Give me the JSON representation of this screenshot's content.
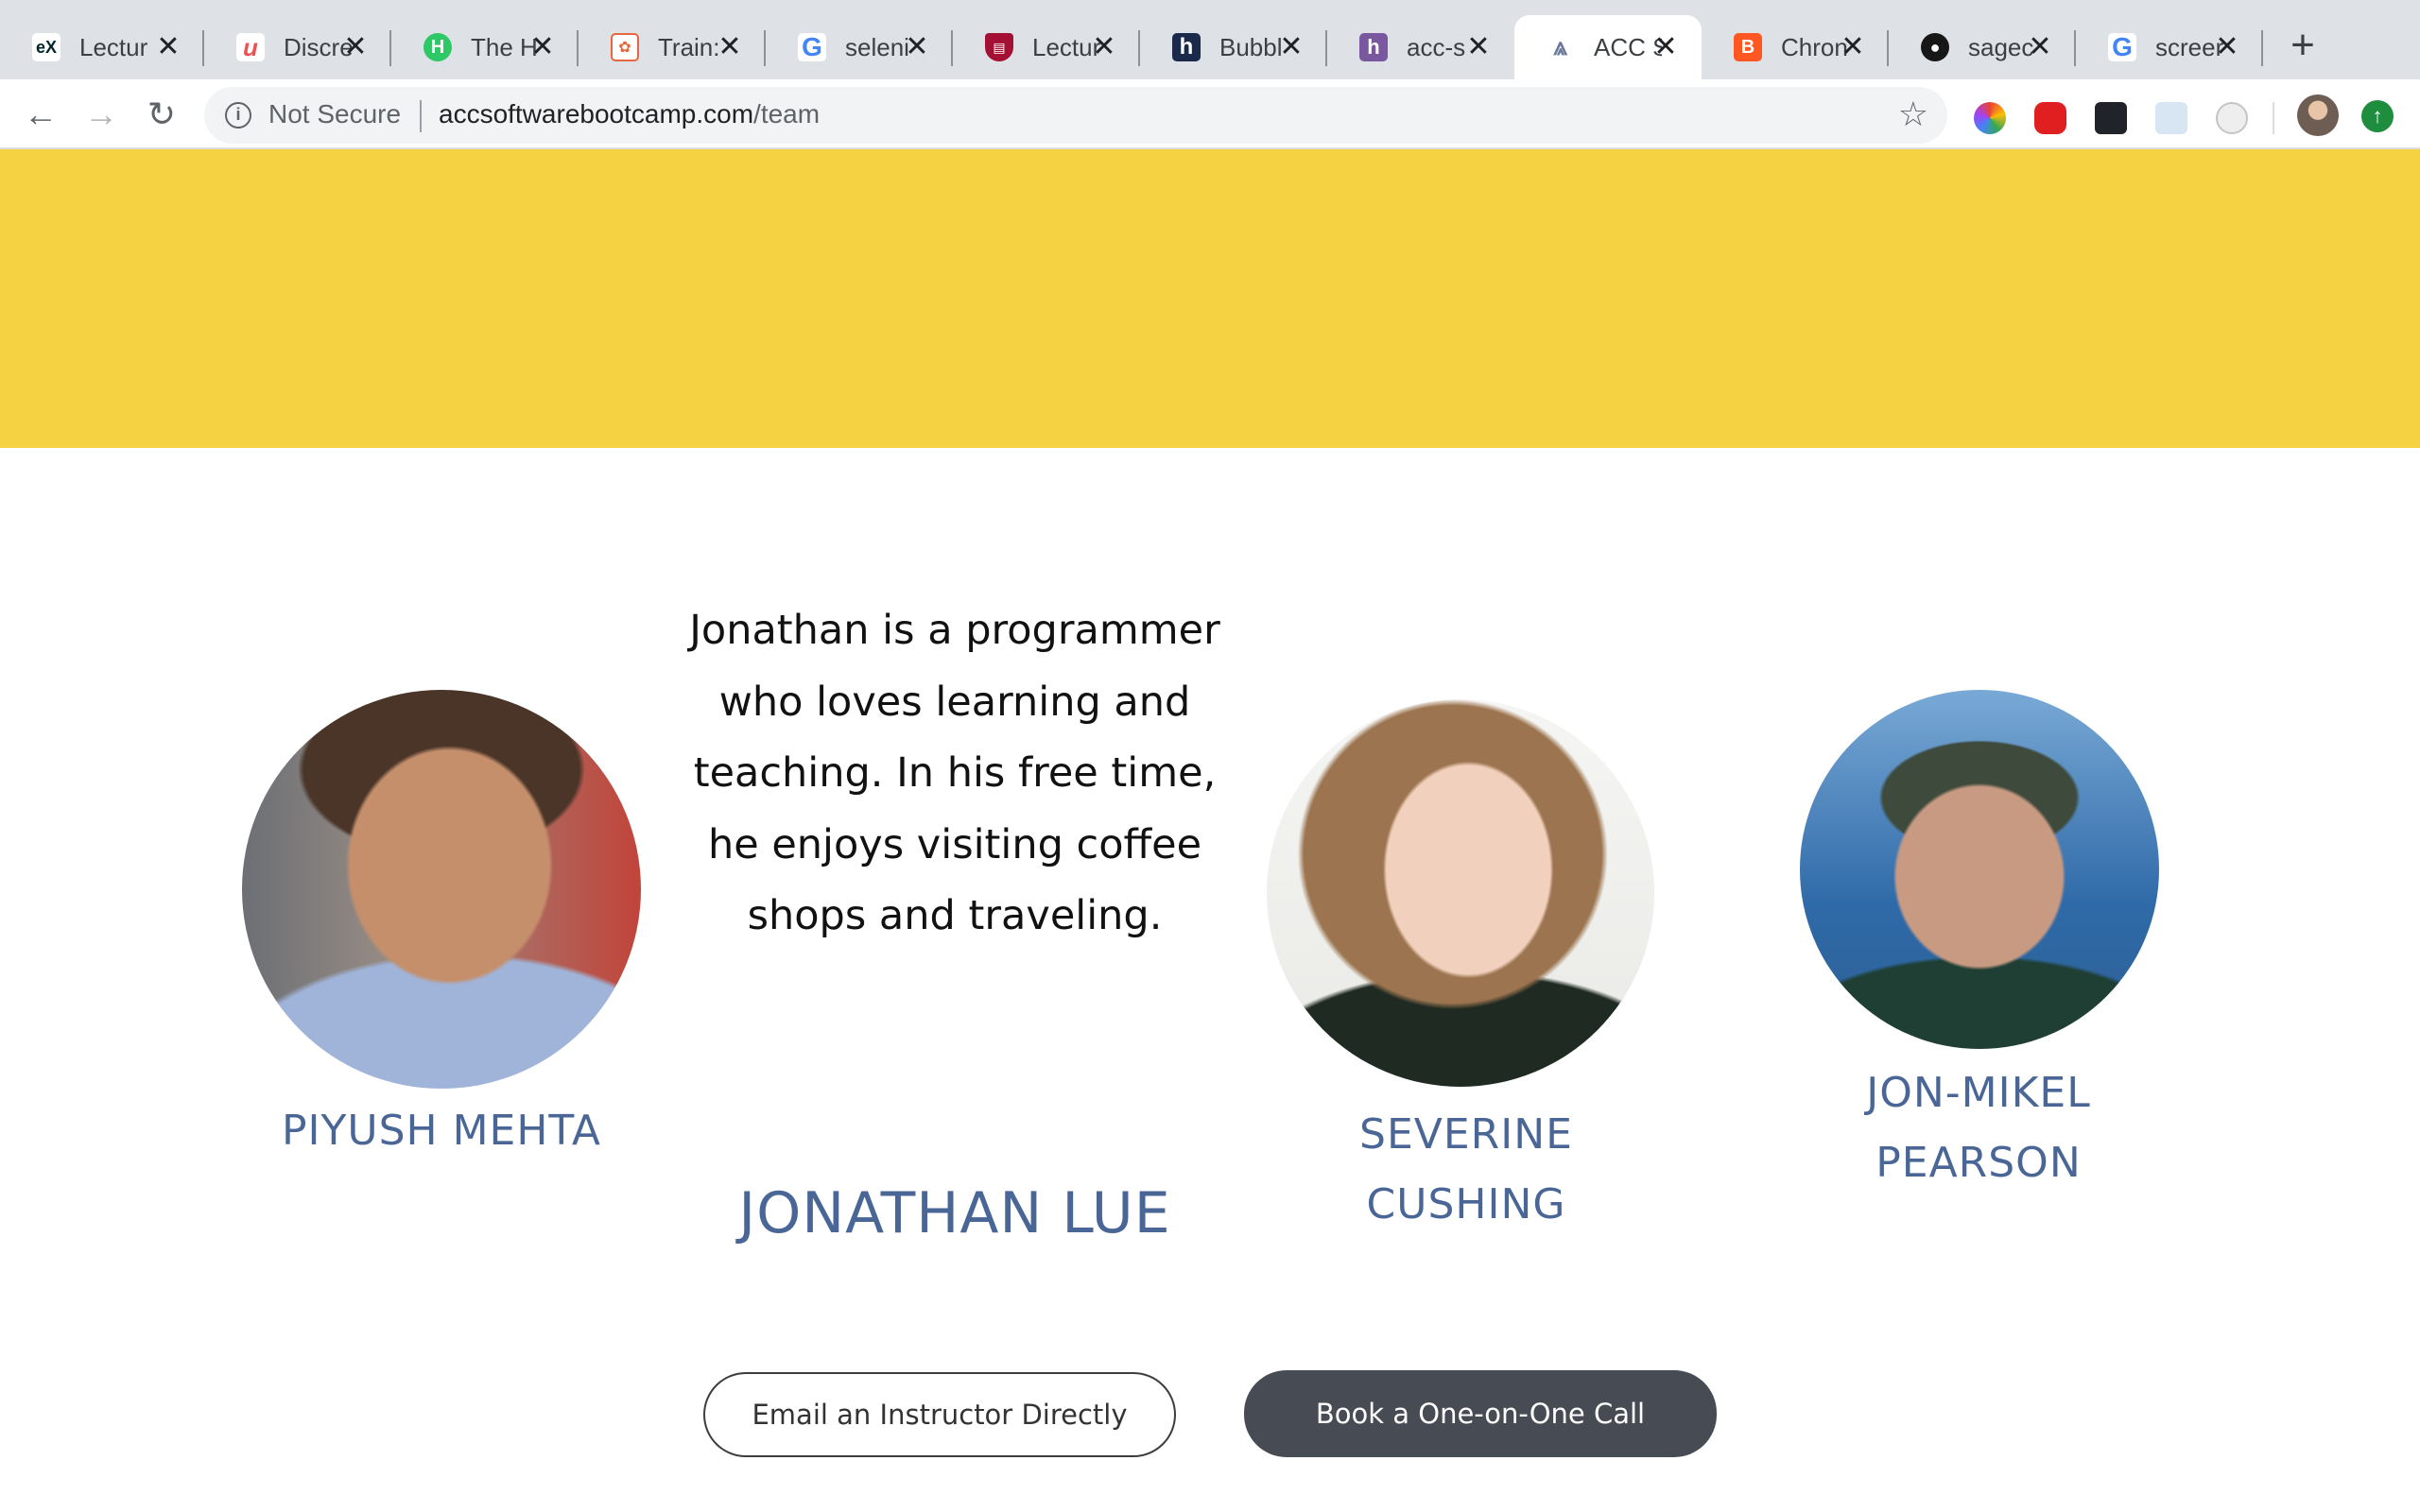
{
  "browser": {
    "tabs": [
      {
        "label": "Lectur",
        "icon": "edx-icon",
        "color": "#02262b"
      },
      {
        "label": "Discre",
        "icon": "udemy-icon",
        "color": "#ec5252"
      },
      {
        "label": "The H",
        "icon": "hackerrank-icon",
        "color": "#2ec866"
      },
      {
        "label": "Train:",
        "icon": "codesignal-icon",
        "color": "#e8663d"
      },
      {
        "label": "seleni",
        "icon": "google-icon",
        "color": "#4285f4"
      },
      {
        "label": "Lectur",
        "icon": "harvard-shield-icon",
        "color": "#a41034"
      },
      {
        "label": "Bubbl",
        "icon": "h-logo-icon",
        "color": "#1b2a4a"
      },
      {
        "label": "acc-s",
        "icon": "heroku-icon",
        "color": "#79589f"
      },
      {
        "label": "ACC S",
        "icon": "acc-rocket-icon",
        "color": "#6c7a9c",
        "active": true
      },
      {
        "label": "Chron",
        "icon": "blogger-icon",
        "color": "#ff5722"
      },
      {
        "label": "sagec",
        "icon": "github-icon",
        "color": "#181717"
      },
      {
        "label": "screer",
        "icon": "google-icon",
        "color": "#4285f4"
      }
    ],
    "omnibox": {
      "security_label": "Not Secure",
      "url_host": "accsoftwarebootcamp.com",
      "url_path": "/team"
    }
  },
  "page": {
    "banner_color": "#f5d242",
    "members": [
      {
        "name": "PIYUSH MEHTA"
      },
      {
        "name": "JONATHAN LUE",
        "bio": "Jonathan is a programmer who loves learning and teaching. In his free time, he enjoys visiting coffee shops and traveling."
      },
      {
        "name_line1": "SEVERINE",
        "name_line2": "CUSHING"
      },
      {
        "name_line1": "JON-MIKEL",
        "name_line2": "PEARSON"
      }
    ],
    "buttons": {
      "email": "Email an Instructor Directly",
      "book": "Book a One-on-One Call"
    }
  }
}
